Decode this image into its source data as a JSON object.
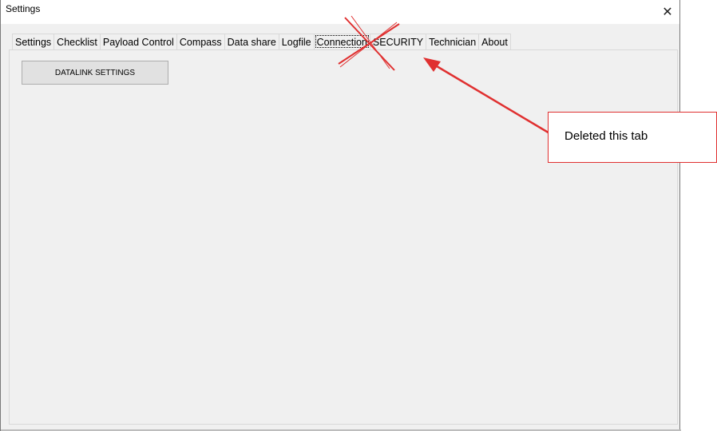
{
  "window": {
    "title": "Settings"
  },
  "tabs": [
    {
      "label": "Settings"
    },
    {
      "label": "Checklist"
    },
    {
      "label": "Payload Control"
    },
    {
      "label": "Compass"
    },
    {
      "label": "Data share"
    },
    {
      "label": "Logfile"
    },
    {
      "label": "Connection"
    },
    {
      "label": "SECURITY"
    },
    {
      "label": "Technician"
    },
    {
      "label": "About"
    }
  ],
  "panel": {
    "button_label": "DATALINK SETTINGS"
  },
  "annotation": {
    "text": "Deleted this tab",
    "color": "#e03030"
  }
}
